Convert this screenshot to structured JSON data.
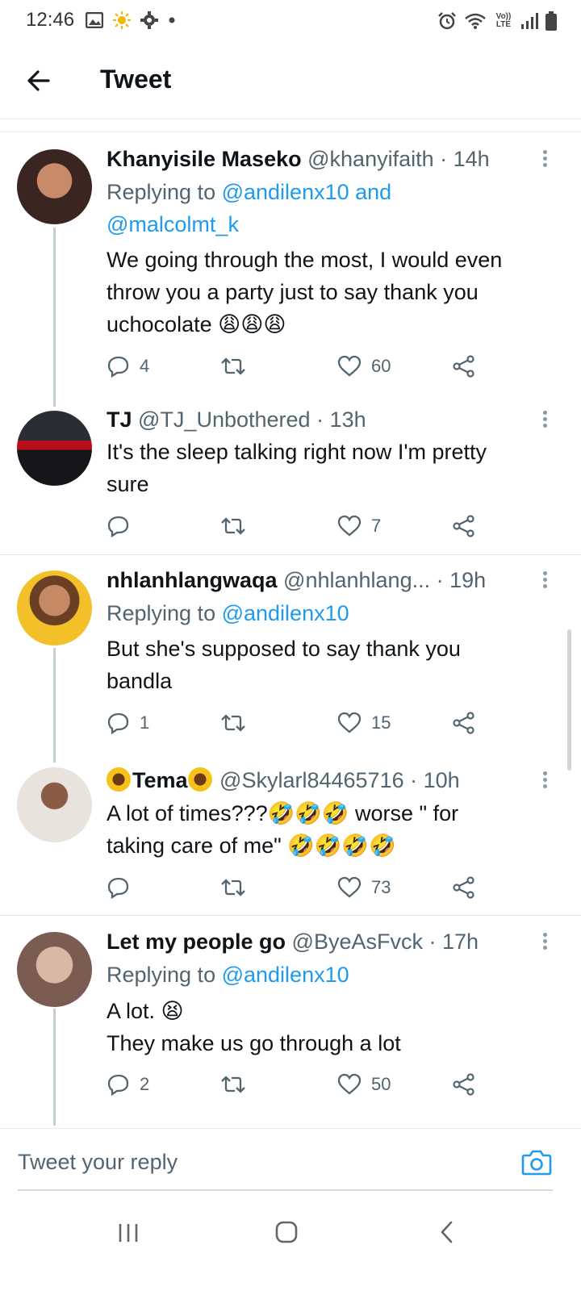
{
  "status_bar": {
    "time": "12:46",
    "left_icons": [
      "image-icon",
      "sun-icon",
      "gear-icon",
      "dot-icon"
    ],
    "right_icons": [
      "alarm-icon",
      "wifi-icon",
      "volte-icon",
      "signal-icon",
      "battery-icon"
    ],
    "volte_text": "Vo)) LTE"
  },
  "header": {
    "title": "Tweet",
    "back_icon": "arrow-left-icon"
  },
  "tweets": [
    {
      "name": "Khanyisile Maseko",
      "handle": "@khanyifaith",
      "time": "· 14h",
      "replying_prefix": "Replying to ",
      "replying_line1_mention": "@andilenx10 and",
      "replying_line2_mention": "@malcolmt_k",
      "text_lines": [
        "We going through the most, I would even",
        "throw you a party just to say thank you",
        "uchocolate "
      ],
      "emoji": "😩😩😩",
      "replies": "4",
      "retweets": "",
      "likes": "60",
      "avatar_colors": [
        "#3a2520",
        "#c98a6a"
      ]
    },
    {
      "name": "TJ",
      "handle": "@TJ_Unbothered",
      "time": "· 13h",
      "text_lines": [
        "It's the sleep talking right now I'm pretty",
        "sure"
      ],
      "replies": "",
      "retweets": "",
      "likes": "7",
      "avatar_colors": [
        "#14161a",
        "#b8101a"
      ]
    },
    {
      "name": "nhlanhlangwaqa",
      "handle": "@nhlanhlang...",
      "time": "· 19h",
      "replying_prefix": "Replying to ",
      "replying_line1_mention": "@andilenx10",
      "text_lines": [
        "But she's supposed to say thank you",
        "bandla"
      ],
      "replies": "1",
      "retweets": "",
      "likes": "15",
      "avatar_colors": [
        "#f3c02a",
        "#6a3f24"
      ]
    },
    {
      "name": "Tema",
      "handle": "@Skylarl84465716",
      "time": "· 10h",
      "text_line1_a": "A lot of times???",
      "text_line1_b": " worse \" for",
      "text_line2": "taking care of me\" ",
      "emoji_line1": "🤣🤣🤣",
      "emoji_line2": "🤣🤣🤣🤣",
      "replies": "",
      "retweets": "",
      "likes": "73",
      "avatar_colors": [
        "#e9e3de",
        "#7b5a48"
      ]
    },
    {
      "name": "Let my people go",
      "handle": "@ByeAsFvck",
      "time": "· 17h",
      "replying_prefix": "Replying to ",
      "replying_line1_mention": "@andilenx10",
      "text_line1": "A lot. ",
      "text_line1_emoji": "😫",
      "text_line2": "They make us go through a lot",
      "replies": "2",
      "retweets": "",
      "likes": "50",
      "avatar_colors": [
        "#7a5c52",
        "#d9b8a6"
      ]
    }
  ],
  "reply_bar": {
    "placeholder": "Tweet your reply",
    "camera_icon": "camera-icon"
  },
  "nav_bar": {
    "icons": [
      "recent-apps-icon",
      "home-icon",
      "back-icon"
    ]
  },
  "colors": {
    "link": "#1d9bf0",
    "secondary_text": "#536471",
    "divider": "#e6e9ec",
    "thread_line": "#c4cfd6"
  }
}
